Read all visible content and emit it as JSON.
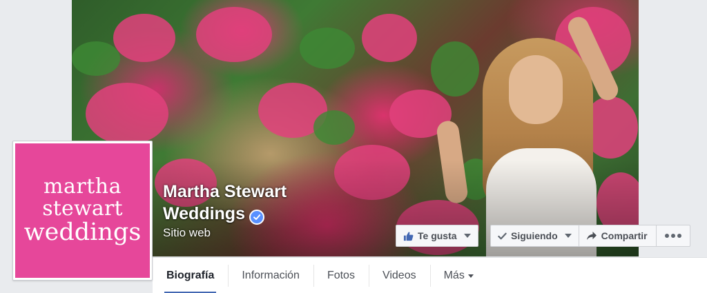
{
  "page": {
    "name_line1": "Martha Stewart",
    "name_line2": "Weddings",
    "category": "Sitio web",
    "verified": true
  },
  "profile_logo": {
    "line1": "martha",
    "line2": "stewart",
    "line3": "weddings",
    "background_color": "#e6479a"
  },
  "actions": {
    "like_label": "Te gusta",
    "following_label": "Siguiendo",
    "share_label": "Compartir",
    "more_icon": "ellipsis-icon"
  },
  "tabs": [
    {
      "label": "Biografía",
      "active": true
    },
    {
      "label": "Información",
      "active": false
    },
    {
      "label": "Fotos",
      "active": false
    },
    {
      "label": "Videos",
      "active": false
    },
    {
      "label": "Más",
      "active": false
    }
  ],
  "colors": {
    "accent": "#4267b2",
    "verified_badge": "#5890ff",
    "like_icon": "#4267b2"
  }
}
